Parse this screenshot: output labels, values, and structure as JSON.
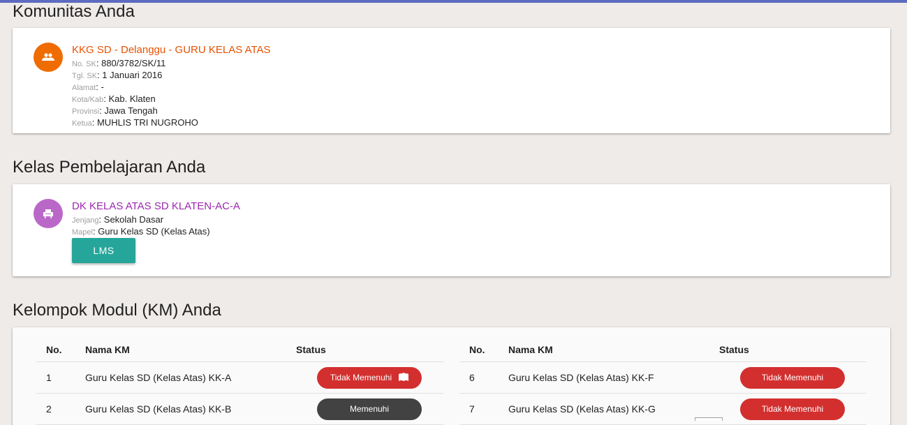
{
  "colors": {
    "top_bar": "#5c6bc0",
    "community_accent": "#ef6c00",
    "class_accent": "#ab47bc",
    "lms_button": "#26a69a",
    "status_fail": "#d32f2f",
    "status_ok": "#424242"
  },
  "community": {
    "section_title": "Komunitas Anda",
    "icon": "group-icon",
    "name": "KKG SD - Delanggu - GURU KELAS ATAS",
    "fields": [
      {
        "label": "No. SK",
        "value": ": 880/3782/SK/11"
      },
      {
        "label": "Tgl. SK",
        "value": ": 1 Januari 2016"
      },
      {
        "label": "Alamat",
        "value": ": -"
      },
      {
        "label": "Kota/Kab",
        "value": ": Kab. Klaten"
      },
      {
        "label": "Provinsi",
        "value": ": Jawa Tengah"
      },
      {
        "label": "Ketua",
        "value": ": MUHLIS TRI NUGROHO"
      }
    ]
  },
  "classes": {
    "section_title": "Kelas Pembelajaran Anda",
    "icon": "chair-icon",
    "name": "DK KELAS ATAS SD KLATEN-AC-A",
    "fields": [
      {
        "label": "Jenjang",
        "value": ": Sekolah Dasar"
      },
      {
        "label": "Mapel",
        "value": ": Guru Kelas SD (Kelas Atas)"
      }
    ],
    "lms_label": "LMS"
  },
  "modules": {
    "section_title": "Kelompok Modul (KM) Anda",
    "headers": {
      "no": "No.",
      "name": "Nama KM",
      "status": "Status"
    },
    "left": [
      {
        "no": "1",
        "name": "Guru Kelas SD (Kelas Atas) KK-A",
        "status": "Tidak Memenuhi",
        "kind": "fail",
        "icon": "book-icon"
      },
      {
        "no": "2",
        "name": "Guru Kelas SD (Kelas Atas) KK-B",
        "status": "Memenuhi",
        "kind": "ok"
      }
    ],
    "right": [
      {
        "no": "6",
        "name": "Guru Kelas SD (Kelas Atas) KK-F",
        "status": "Tidak Memenuhi",
        "kind": "fail"
      },
      {
        "no": "7",
        "name": "Guru Kelas SD (Kelas Atas) KK-G",
        "status": "Tidak Memenuhi",
        "kind": "fail"
      }
    ]
  }
}
